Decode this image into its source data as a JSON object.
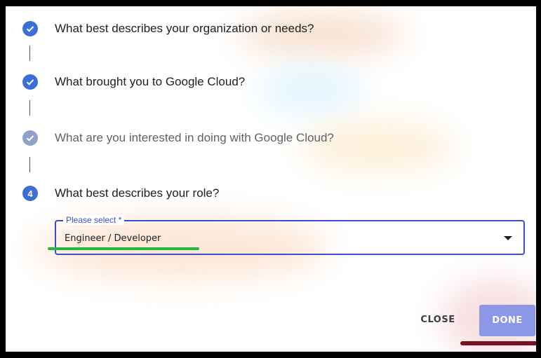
{
  "colors": {
    "step_complete": "#3c6fd6",
    "step_complete_muted": "#8ea2cc",
    "step_current": "#3c6fd6",
    "field_border": "#3c4fc9",
    "done_button": "#8c97e6",
    "green_underline": "#1fb944",
    "red_underline": "#7a1022"
  },
  "steps": [
    {
      "label": "What best describes your organization or needs?",
      "status": "complete",
      "icon": "check-icon"
    },
    {
      "label": "What brought you to Google Cloud?",
      "status": "complete",
      "icon": "check-icon"
    },
    {
      "label": "What are you interested in doing with Google Cloud?",
      "status": "complete",
      "icon": "check-icon"
    },
    {
      "label": "What best describes your role?",
      "status": "current",
      "number": "4"
    }
  ],
  "role_select": {
    "label": "Please select *",
    "value": "Engineer / Developer"
  },
  "actions": {
    "close_label": "CLOSE",
    "done_label": "DONE"
  }
}
